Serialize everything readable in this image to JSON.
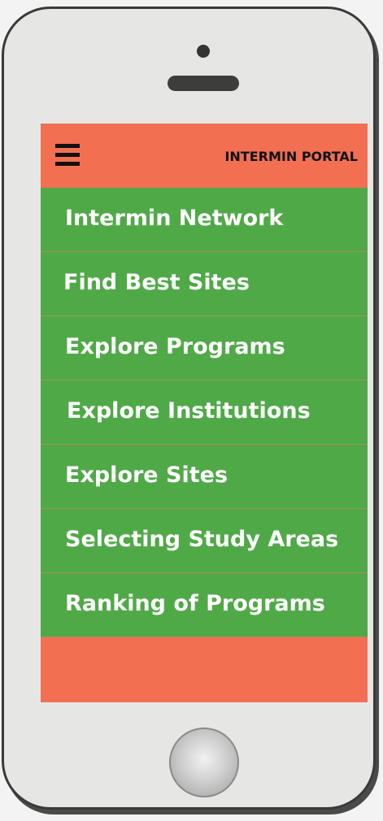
{
  "header": {
    "title": "INTERMIN PORTAL"
  },
  "menu": {
    "items": [
      {
        "label": "Intermin Network"
      },
      {
        "label": "Find Best Sites"
      },
      {
        "label": "Explore Programs"
      },
      {
        "label": "Explore Institutions"
      },
      {
        "label": "Explore Sites"
      },
      {
        "label": "Selecting Study Areas"
      },
      {
        "label": "Ranking of Programs"
      }
    ]
  },
  "icons": {
    "menu": "hamburger-menu-icon"
  },
  "colors": {
    "header_bg": "#f26f52",
    "menu_item_bg": "#4fa947",
    "menu_text": "#ffffff",
    "title_text": "#111111",
    "phone_body": "#e6e7e5"
  }
}
